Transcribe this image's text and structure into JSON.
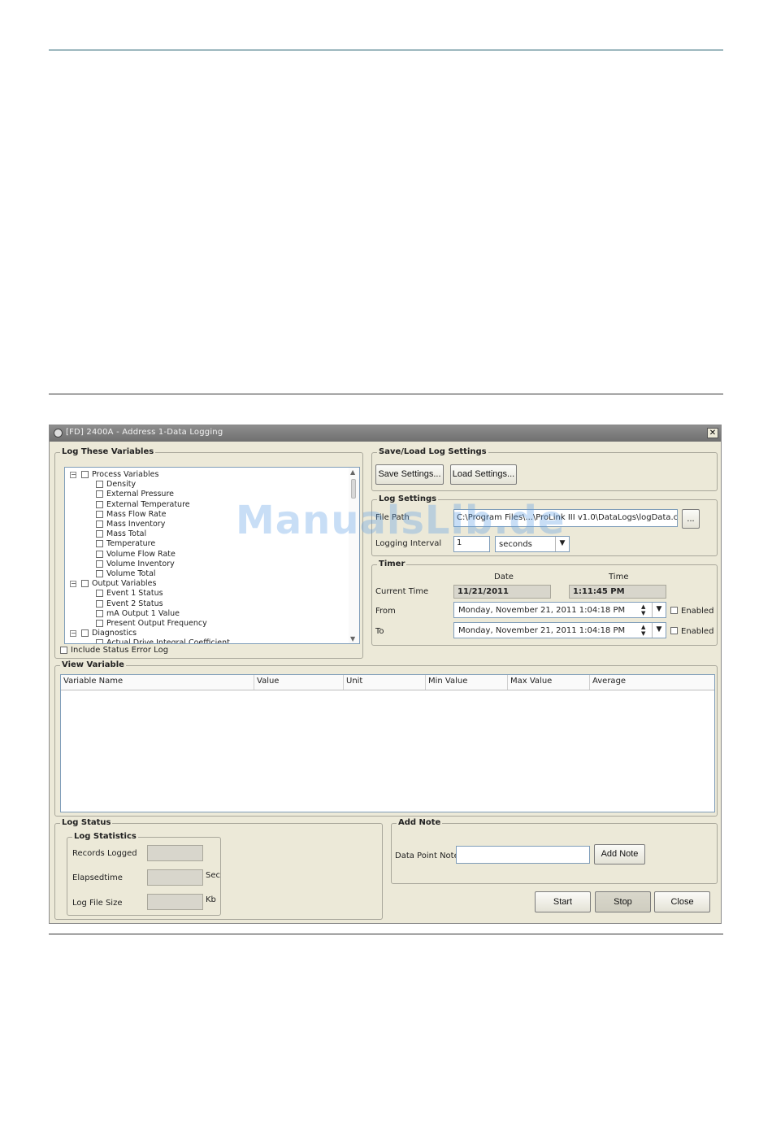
{
  "window": {
    "title": "[FD] 2400A - Address 1-Data Logging",
    "close_label": "✕"
  },
  "log_vars": {
    "legend": "Log These Variables",
    "tree": [
      {
        "label": "Process Variables",
        "level": 0
      },
      {
        "label": "Density",
        "level": 1
      },
      {
        "label": "External Pressure",
        "level": 1
      },
      {
        "label": "External Temperature",
        "level": 1
      },
      {
        "label": "Mass Flow Rate",
        "level": 1
      },
      {
        "label": "Mass Inventory",
        "level": 1
      },
      {
        "label": "Mass Total",
        "level": 1
      },
      {
        "label": "Temperature",
        "level": 1
      },
      {
        "label": "Volume Flow Rate",
        "level": 1
      },
      {
        "label": "Volume Inventory",
        "level": 1
      },
      {
        "label": "Volume Total",
        "level": 1
      },
      {
        "label": "Output Variables",
        "level": 0
      },
      {
        "label": "Event 1 Status",
        "level": 1
      },
      {
        "label": "Event 2 Status",
        "level": 1
      },
      {
        "label": "mA Output 1 Value",
        "level": 1
      },
      {
        "label": "Present Output Frequency",
        "level": 1
      },
      {
        "label": "Diagnostics",
        "level": 0
      },
      {
        "label": "Actual Drive Integral Coefficient",
        "level": 1
      }
    ],
    "include_status": "Include Status Error Log"
  },
  "save_load": {
    "legend": "Save/Load Log Settings",
    "save_label": "Save Settings...",
    "load_label": "Load Settings..."
  },
  "log_settings": {
    "legend": "Log Settings",
    "file_path_label": "File Path",
    "file_path_value": "C:\\Program Files\\...\\ProLink III v1.0\\DataLogs\\logData.csv",
    "browse_label": "...",
    "interval_label": "Logging Interval",
    "interval_value": "1",
    "interval_unit": "seconds"
  },
  "timer": {
    "legend": "Timer",
    "date_header": "Date",
    "time_header": "Time",
    "current_label": "Current Time",
    "current_date": "11/21/2011",
    "current_time": "1:11:45 PM",
    "from_label": "From",
    "from_value": "Monday, November 21, 2011 1:04:18 PM",
    "to_label": "To",
    "to_value": "Monday, November 21, 2011 1:04:18 PM",
    "enabled_label": "Enabled"
  },
  "view_variable": {
    "legend": "View Variable",
    "columns": [
      "Variable Name",
      "Value",
      "Unit",
      "Min Value",
      "Max Value",
      "Average"
    ]
  },
  "log_status": {
    "legend": "Log Status",
    "stats_legend": "Log Statistics",
    "records_label": "Records Logged",
    "elapsed_label": "Elapsedtime",
    "elapsed_unit": "Sec",
    "size_label": "Log File Size",
    "size_unit": "Kb"
  },
  "add_note": {
    "legend": "Add Note",
    "point_label": "Data Point Note",
    "button_label": "Add Note"
  },
  "actions": {
    "start": "Start",
    "stop": "Stop",
    "close": "Close"
  },
  "watermark": "ManualsLib.de"
}
